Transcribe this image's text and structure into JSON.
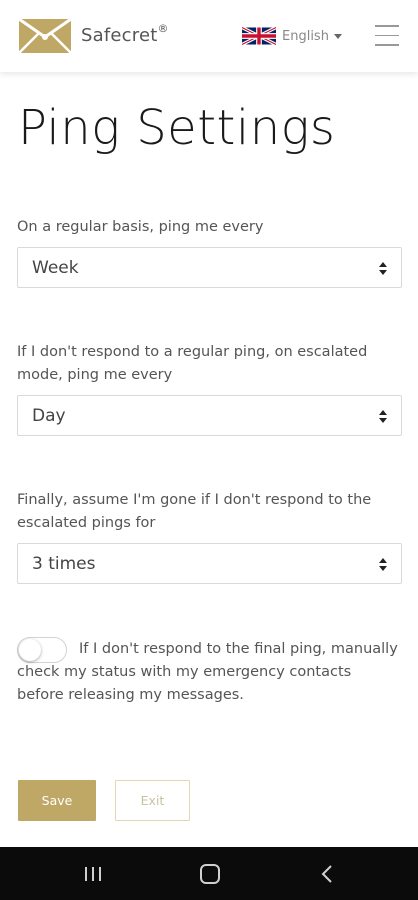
{
  "header": {
    "brand": "Safecret",
    "brand_mark": "®",
    "language": "English",
    "brand_color": "#bfa765"
  },
  "page": {
    "title": "Ping Settings"
  },
  "settings": {
    "regular": {
      "label": "On a regular basis, ping me every",
      "value": "Week"
    },
    "escalated": {
      "label": "If I don't respond to a regular ping, on escalated mode, ping me every",
      "value": "Day"
    },
    "final": {
      "label": "Finally, assume I'm gone if I don't respond to the escalated pings for",
      "value": "3 times"
    },
    "manual_check": {
      "label": "If I don't respond to the final ping, manually check my status with my emergency contacts before releasing my messages.",
      "enabled": false
    }
  },
  "actions": {
    "save": "Save",
    "exit": "Exit"
  },
  "system_nav": {
    "icons": [
      "recent-apps-icon",
      "home-icon",
      "back-icon"
    ]
  }
}
